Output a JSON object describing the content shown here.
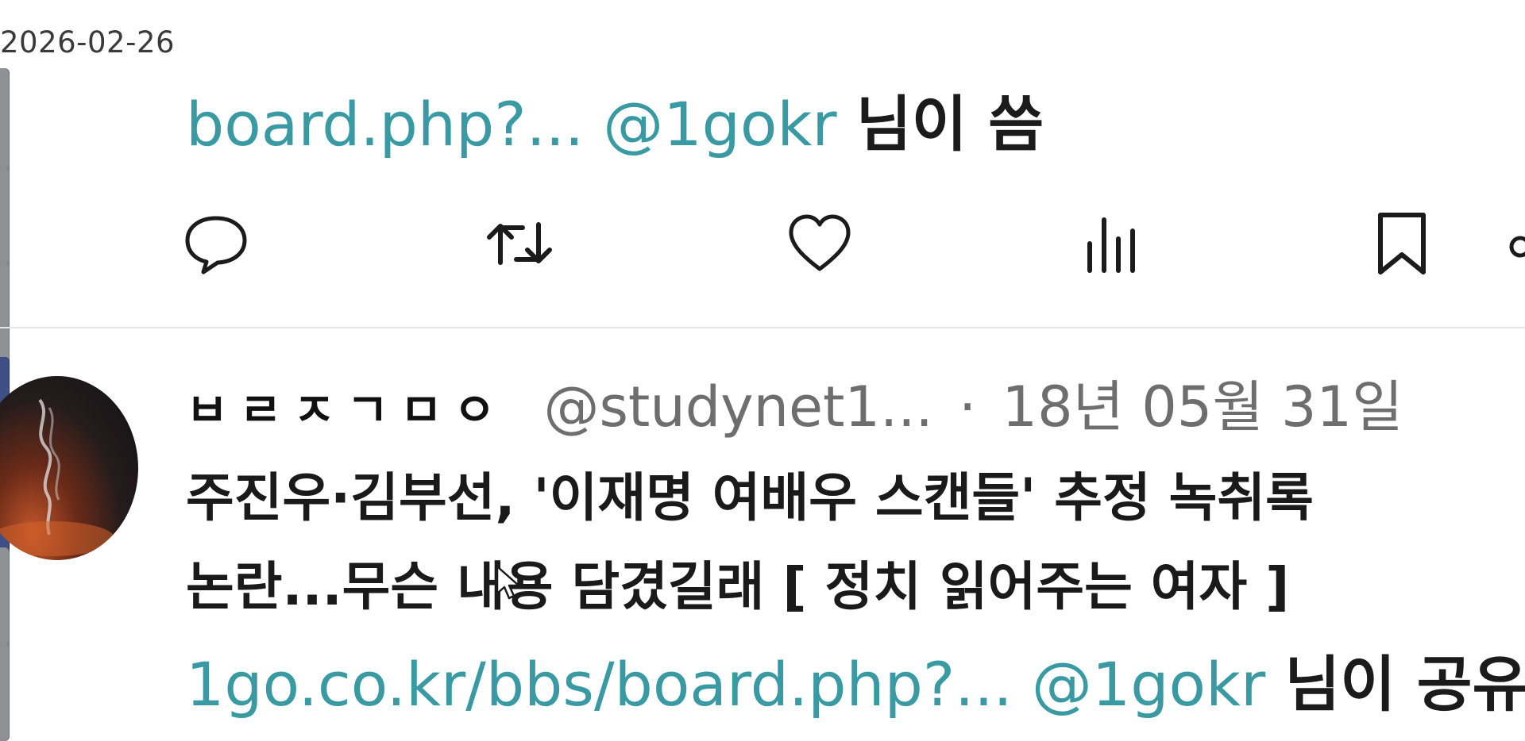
{
  "date_stamp": "2026-02-26",
  "tweet_top": {
    "link_text": "board.php?...",
    "mention": "@1gokr",
    "suffix": "님이 씀"
  },
  "actions": [
    "reply-icon",
    "retweet-icon",
    "like-icon",
    "views-icon",
    "bookmark-icon",
    "share-icon"
  ],
  "tweet2": {
    "display_name": "ㅂㄹㅈㄱㅁㅇ",
    "handle": "@studynet1...",
    "separator": "·",
    "date": "18년 05월 31일",
    "body_line1": "주진우·김부선, '이재명 여배우 스캔들' 추정 녹취록",
    "body_line2": "논란...무슨 내용 담겼길래 [ 정치 읽어주는 여자 ]",
    "link_text": "1go.co.kr/bbs/board.php?...",
    "mention": "@1gokr",
    "suffix": "님이 공유"
  },
  "colors": {
    "link": "#3a9aa3",
    "muted": "#6e6e6e",
    "divider": "#e6e6e6"
  }
}
